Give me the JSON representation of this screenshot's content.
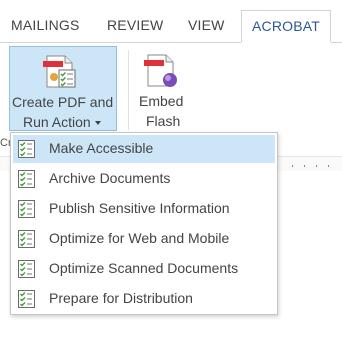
{
  "tabs": [
    "MAILINGS",
    "REVIEW",
    "VIEW",
    "ACROBAT"
  ],
  "active_tab": "ACROBAT",
  "ribbon": {
    "create_button": {
      "line1": "Create PDF and",
      "line2": "Run Action"
    },
    "embed_button": {
      "line1": "Embed",
      "line2": "Flash"
    },
    "clipped_group_label": "Cr"
  },
  "menu": {
    "items": [
      {
        "label": "Make Accessible",
        "highlighted": true
      },
      {
        "label": "Archive Documents",
        "highlighted": false
      },
      {
        "label": "Publish Sensitive Information",
        "highlighted": false
      },
      {
        "label": "Optimize for Web and Mobile",
        "highlighted": false
      },
      {
        "label": "Optimize Scanned Documents",
        "highlighted": false
      },
      {
        "label": "Prepare for Distribution",
        "highlighted": false
      }
    ]
  },
  "colors": {
    "accent": "#2b579a",
    "highlight": "#cde6f7",
    "highlight_border": "#92c0e0",
    "pdf_red": "#e0313a",
    "check_green": "#3f9c35"
  }
}
